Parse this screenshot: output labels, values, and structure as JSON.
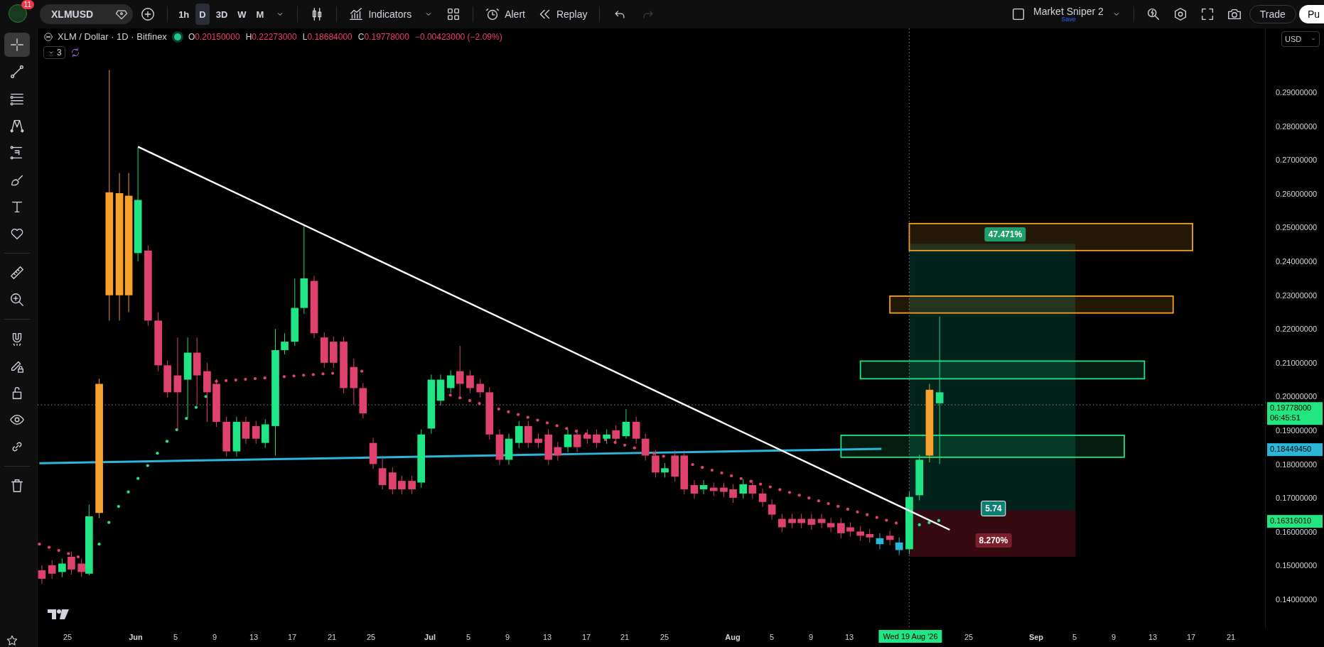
{
  "top_bar": {
    "notifications": "11",
    "symbol": "XLMUSD",
    "timeframes": [
      {
        "label": "1h",
        "selected": false
      },
      {
        "label": "D",
        "selected": true
      },
      {
        "label": "3D",
        "selected": false
      },
      {
        "label": "W",
        "selected": false
      },
      {
        "label": "M",
        "selected": false
      }
    ],
    "indicators": "Indicators",
    "alert": "Alert",
    "replay": "Replay",
    "history": [
      {
        "kind": "undo",
        "disabled": false
      },
      {
        "kind": "redo",
        "disabled": true
      }
    ],
    "layout": {
      "name": "Market Sniper 2",
      "save": "Save"
    },
    "trade": "Trade",
    "publish": "Pu"
  },
  "tool_groups": [
    {
      "tools": [
        {
          "kind": "crosshair",
          "selected": true
        },
        {
          "kind": "trendline",
          "selected": false
        },
        {
          "kind": "fib",
          "selected": false
        },
        {
          "kind": "pattern",
          "selected": false
        },
        {
          "kind": "forecast",
          "selected": false
        },
        {
          "kind": "brush",
          "selected": false
        },
        {
          "kind": "text",
          "selected": false
        },
        {
          "kind": "heart",
          "selected": false
        }
      ]
    },
    {
      "tools": [
        {
          "kind": "ruler",
          "selected": false
        },
        {
          "kind": "zoom",
          "selected": false
        }
      ]
    },
    {
      "tools": [
        {
          "kind": "magnet",
          "selected": false
        },
        {
          "kind": "lockdraw",
          "selected": false
        },
        {
          "kind": "lock",
          "selected": false
        },
        {
          "kind": "eye",
          "selected": false
        },
        {
          "kind": "link",
          "selected": false
        }
      ]
    },
    {
      "tools": [
        {
          "kind": "trash",
          "selected": false
        }
      ]
    }
  ],
  "legend": {
    "title": "XLM / Dollar · 1D · Bitfinex",
    "values": [
      {
        "label": "O",
        "value": "0.20150000"
      },
      {
        "label": "H",
        "value": "0.22273000"
      },
      {
        "label": "L",
        "value": "0.18684000"
      },
      {
        "label": "C",
        "value": "0.19778000"
      }
    ],
    "change": "−0.00423000 (−2.09%)",
    "indicators_count": "3"
  },
  "position_tool": {
    "target": "47.471%",
    "ratio": "5.74",
    "stop": "8.270%"
  },
  "price_axis": {
    "currency": "USD",
    "labels": [
      "0.29000000",
      "0.28000000",
      "0.27000000",
      "0.26000000",
      "0.25000000",
      "0.24000000",
      "0.23000000",
      "0.22000000",
      "0.21000000",
      "0.20000000",
      "0.19000000",
      "0.18000000",
      "0.17000000",
      "0.16000000",
      "0.15000000",
      "0.14000000"
    ],
    "tags": [
      {
        "value": "0.19778000",
        "countdown": "06:45:51",
        "color": "#22e57f"
      },
      {
        "value": "0.18449450",
        "color": "#29b6d8"
      },
      {
        "value": "0.16316010",
        "color": "#22e57f"
      }
    ]
  },
  "time_axis": [
    {
      "label": "25",
      "kind": "day"
    },
    {
      "label": "Jun",
      "kind": "month"
    },
    {
      "label": "5",
      "kind": "day"
    },
    {
      "label": "9",
      "kind": "day"
    },
    {
      "label": "13",
      "kind": "day"
    },
    {
      "label": "17",
      "kind": "day"
    },
    {
      "label": "21",
      "kind": "day"
    },
    {
      "label": "25",
      "kind": "day"
    },
    {
      "label": "Jul",
      "kind": "month"
    },
    {
      "label": "5",
      "kind": "day"
    },
    {
      "label": "9",
      "kind": "day"
    },
    {
      "label": "13",
      "kind": "day"
    },
    {
      "label": "17",
      "kind": "day"
    },
    {
      "label": "21",
      "kind": "day"
    },
    {
      "label": "25",
      "kind": "day"
    },
    {
      "label": "Aug",
      "kind": "month"
    },
    {
      "label": "5",
      "kind": "day"
    },
    {
      "label": "9",
      "kind": "day"
    },
    {
      "label": "13",
      "kind": "day"
    },
    {
      "label": "Wed 19 Aug '26",
      "kind": "cursor"
    },
    {
      "label": "25",
      "kind": "day"
    },
    {
      "label": "Sep",
      "kind": "month"
    },
    {
      "label": "5",
      "kind": "day"
    },
    {
      "label": "9",
      "kind": "day"
    },
    {
      "label": "13",
      "kind": "day"
    },
    {
      "label": "17",
      "kind": "day"
    },
    {
      "label": "21",
      "kind": "day"
    }
  ]
}
